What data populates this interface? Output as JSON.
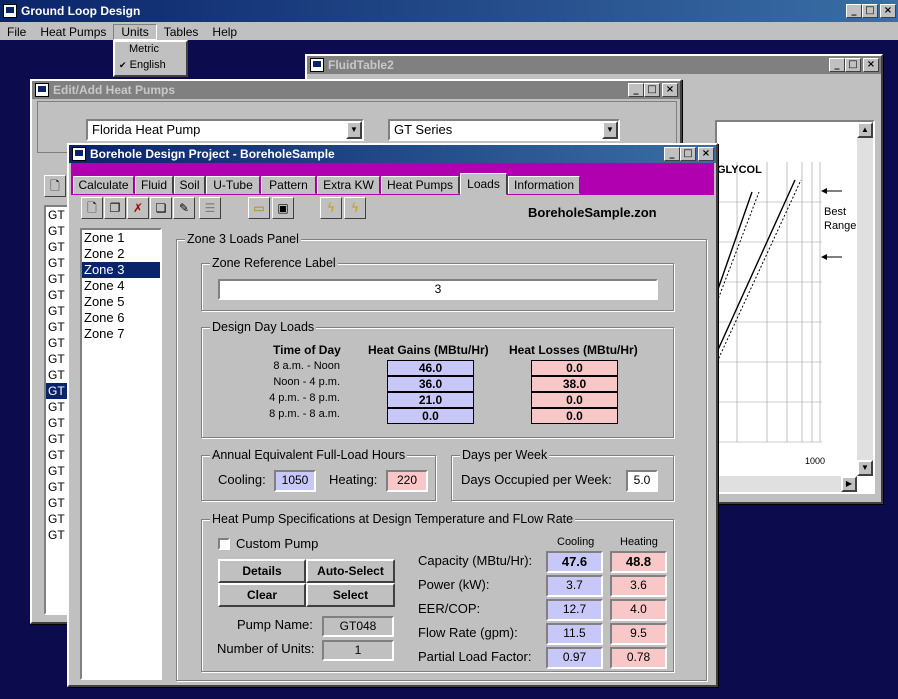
{
  "main_window": {
    "title": "Ground Loop Design",
    "menu": [
      "File",
      "Heat Pumps",
      "Units",
      "Tables",
      "Help"
    ],
    "units_menu": [
      "Metric",
      "English"
    ],
    "units_checked": "English"
  },
  "fluid_window": {
    "title": "FluidTable2",
    "chart_label": "GLYCOL",
    "best_range": [
      "Best",
      "Range"
    ],
    "axis_tick": "1000"
  },
  "heatpump_window": {
    "title": "Edit/Add Heat Pumps",
    "manufacturer": "Florida Heat Pump",
    "series": "GT Series",
    "list_items": [
      "GT",
      "GT",
      "GT",
      "GT",
      "GT",
      "GT",
      "GT",
      "GT",
      "GT",
      "GT",
      "GT",
      "GT",
      "GT",
      "GT",
      "GT",
      "GT",
      "GT",
      "GT",
      "GT",
      "GT",
      "GT"
    ],
    "selected_index": 11
  },
  "borehole_window": {
    "title": "Borehole Design Project - BoreholeSample",
    "tabs": [
      "Calculate",
      "Fluid",
      "Soil",
      "U-Tube",
      "Pattern",
      "Extra KW",
      "Heat Pumps",
      "Loads",
      "Information"
    ],
    "active_tab": "Loads",
    "filename": "BoreholeSample.zon",
    "zones": [
      "Zone 1",
      "Zone 2",
      "Zone 3",
      "Zone 4",
      "Zone 5",
      "Zone 6",
      "Zone 7"
    ],
    "selected_zone": "Zone 3",
    "panel_title": "Zone 3 Loads Panel",
    "zone_reference": {
      "legend": "Zone Reference Label",
      "value": "3"
    },
    "design_day": {
      "legend": "Design Day Loads",
      "col_time": "Time of Day",
      "col_gains": "Heat Gains (MBtu/Hr)",
      "col_losses": "Heat Losses (MBtu/Hr)",
      "rows": [
        {
          "time": "8 a.m. - Noon",
          "gain": "46.0",
          "loss": "0.0"
        },
        {
          "time": "Noon - 4 p.m.",
          "gain": "36.0",
          "loss": "38.0"
        },
        {
          "time": "4 p.m. - 8 p.m.",
          "gain": "21.0",
          "loss": "0.0"
        },
        {
          "time": "8 p.m. - 8 a.m.",
          "gain": "0.0",
          "loss": "0.0"
        }
      ]
    },
    "annual": {
      "legend": "Annual Equivalent Full-Load Hours",
      "cooling_label": "Cooling:",
      "cooling_value": "1050",
      "heating_label": "Heating:",
      "heating_value": "220"
    },
    "days": {
      "legend": "Days per Week",
      "label": "Days Occupied per Week:",
      "value": "5.0"
    },
    "specs": {
      "legend": "Heat Pump Specifications at Design Temperature and FLow Rate",
      "custom_pump": "Custom Pump",
      "buttons": {
        "details": "Details",
        "auto_select": "Auto-Select",
        "clear": "Clear",
        "select": "Select"
      },
      "pump_name_label": "Pump Name:",
      "pump_name": "GT048",
      "units_label": "Number of Units:",
      "units": "1",
      "col_cooling": "Cooling",
      "col_heating": "Heating",
      "rows": [
        {
          "label": "Capacity (MBtu/Hr):",
          "cooling": "47.6",
          "heating": "48.8"
        },
        {
          "label": "Power (kW):",
          "cooling": "3.7",
          "heating": "3.6"
        },
        {
          "label": "EER/COP:",
          "cooling": "12.7",
          "heating": "4.0"
        },
        {
          "label": "Flow Rate (gpm):",
          "cooling": "11.5",
          "heating": "9.5"
        },
        {
          "label": "Partial Load Factor:",
          "cooling": "0.97",
          "heating": "0.78"
        }
      ]
    }
  }
}
